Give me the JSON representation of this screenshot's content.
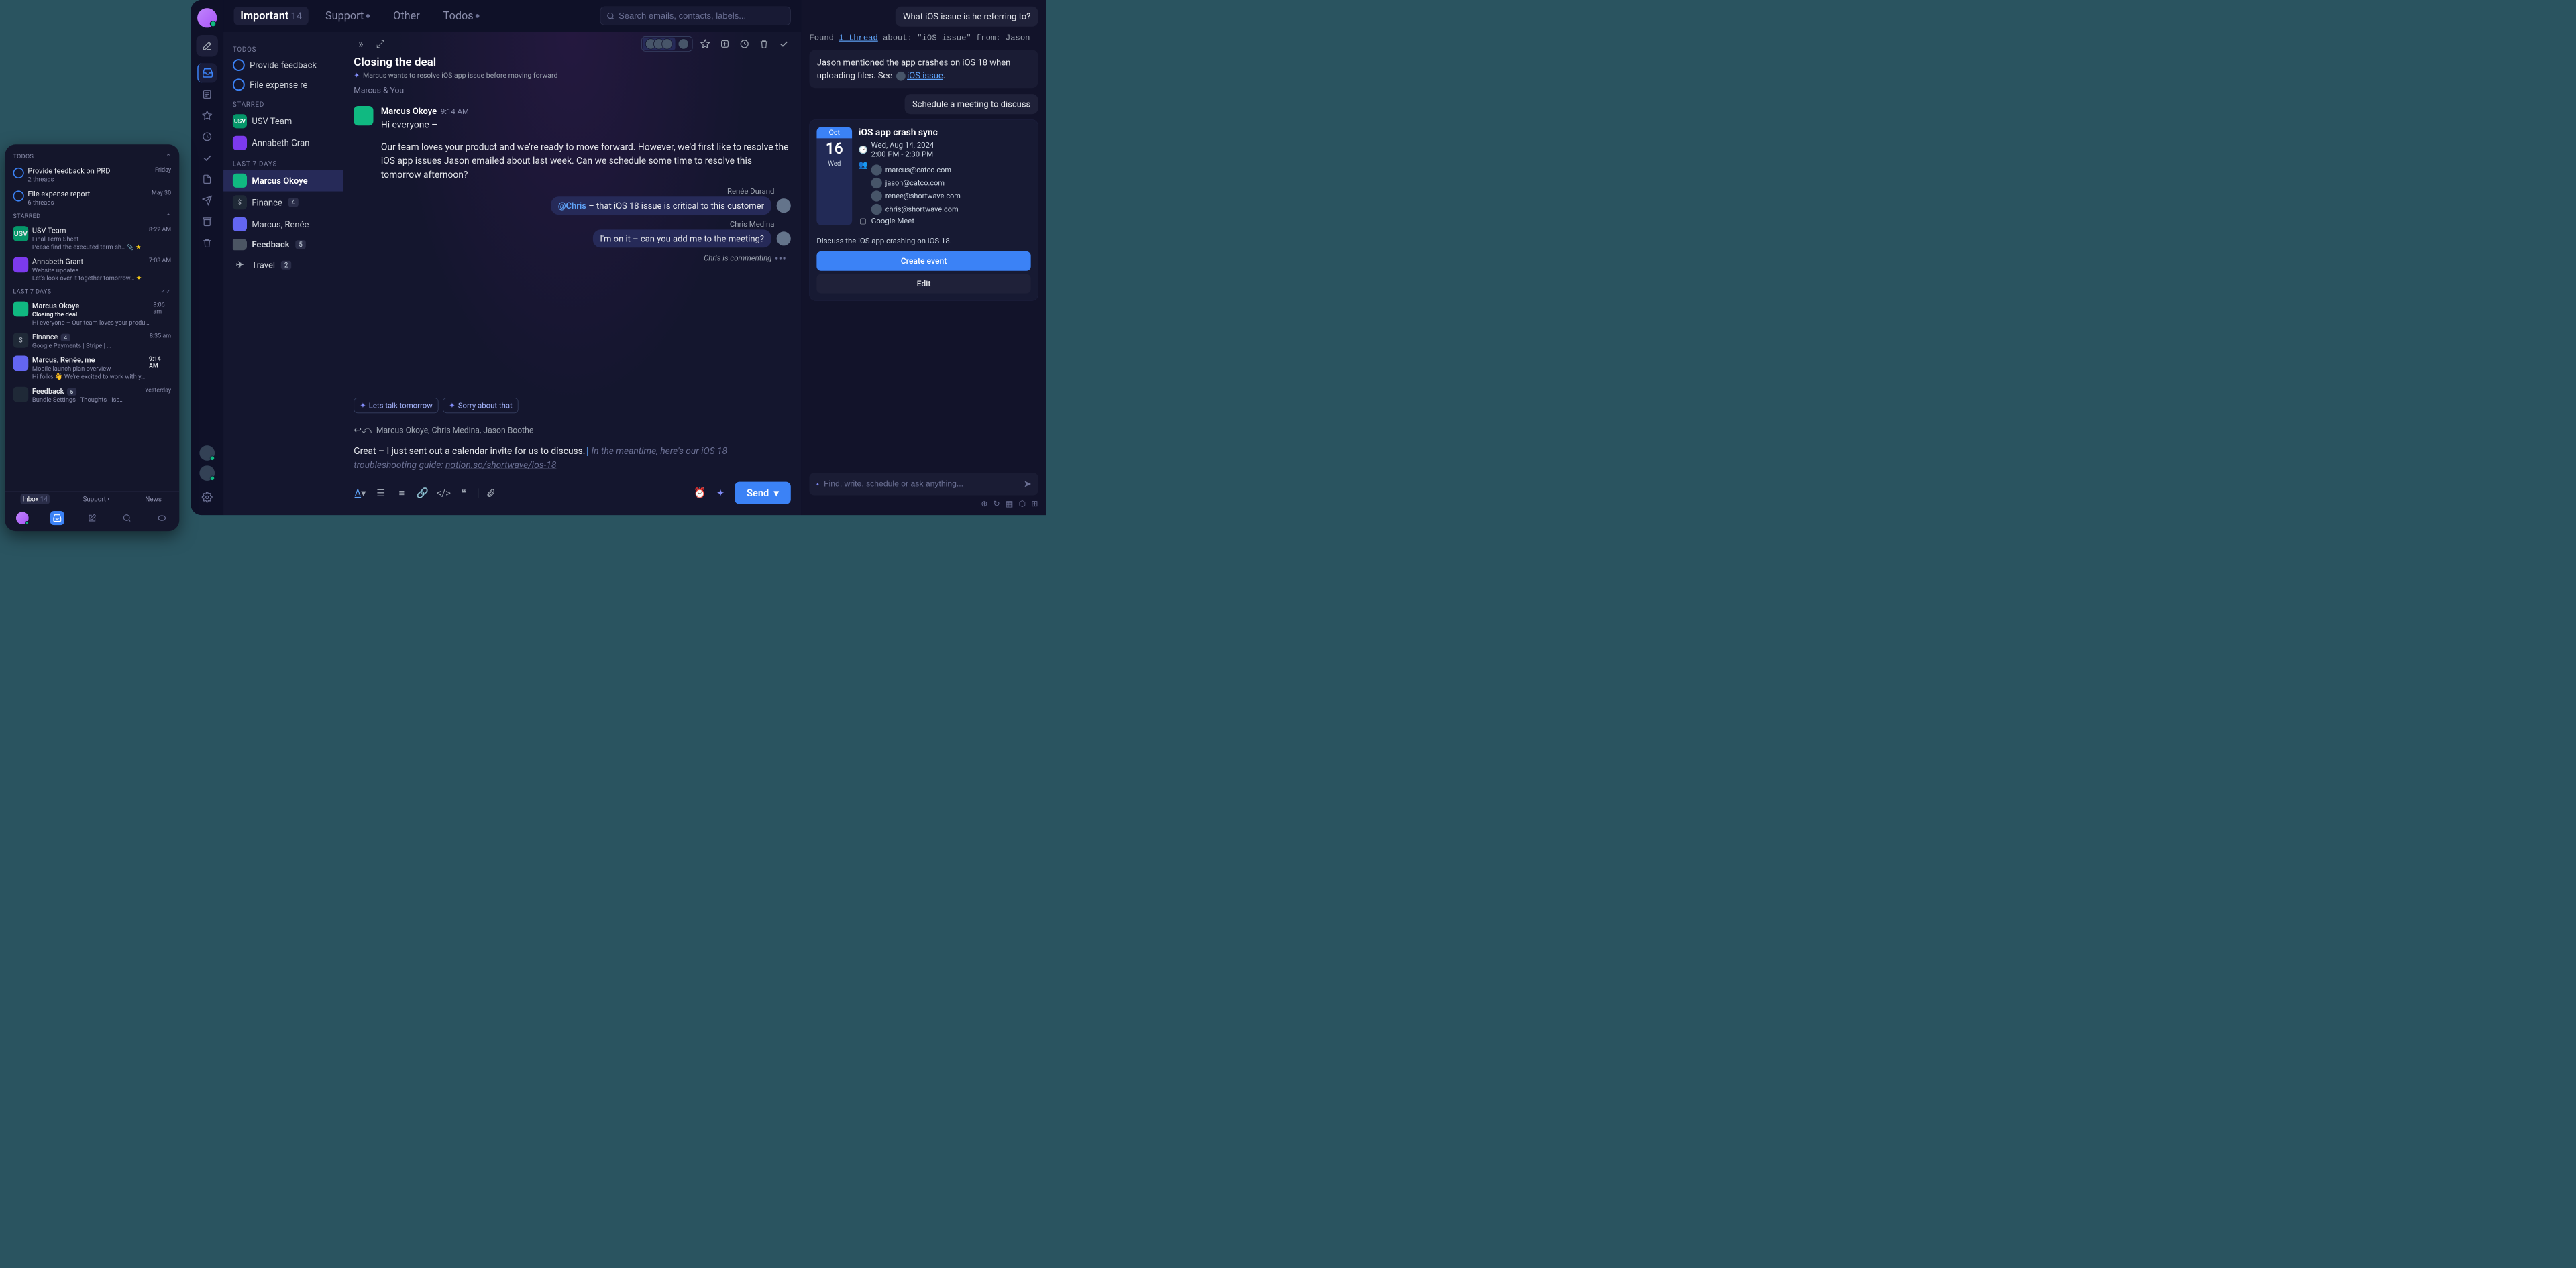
{
  "mobile": {
    "sections": {
      "todos": "TODOS",
      "starred": "STARRED",
      "last7": "LAST 7 DAYS"
    },
    "todos": [
      {
        "title": "Provide feedback on PRD",
        "sub": "2 threads",
        "time": "Friday"
      },
      {
        "title": "File expense report",
        "sub": "6 threads",
        "time": "May 30"
      }
    ],
    "starred": [
      {
        "name": "USV Team",
        "subject": "Final Term Sheet",
        "preview": "Pease find the executed term sh…",
        "time": "8:22 AM",
        "badge": "USV",
        "badge_bg": "#059669",
        "attach": true,
        "star": true
      },
      {
        "name": "Annabeth Grant",
        "subject": "Website updates",
        "preview": "Let's look over it together tomorrow…",
        "time": "7:03 AM",
        "star": true
      }
    ],
    "last7": [
      {
        "name": "Marcus Okoye",
        "subject": "Closing the deal",
        "preview": "Hi everyone – Our team loves your produ…",
        "time": "8:06 am",
        "bold": true
      },
      {
        "name": "Finance",
        "badge_count": "4",
        "icons_row": "Google Payments  |  Stripe  |  …",
        "time": "8:35 am",
        "icon": "$"
      },
      {
        "name": "Marcus, Renée, me",
        "subject": "Mobile launch plan overview",
        "preview": "Hi folks 👋 We're excited to work with y…",
        "time": "9:14 AM",
        "bold": true
      },
      {
        "name": "Feedback",
        "badge_count": "5",
        "subject": "Bundle Settings | Thoughts | Iss…",
        "time": "Yesterday"
      }
    ],
    "bottom_tabs": {
      "inbox": "Inbox",
      "inbox_count": "14",
      "support": "Support",
      "news": "News"
    }
  },
  "tabs": [
    {
      "label": "Important",
      "count": "14",
      "active": true
    },
    {
      "label": "Support",
      "dot": true
    },
    {
      "label": "Other"
    },
    {
      "label": "Todos",
      "dot": true
    }
  ],
  "search_placeholder": "Search emails, contacts, labels...",
  "list": {
    "sections": {
      "todos": "TODOS",
      "starred": "STARRED",
      "last7": "LAST 7 DAYS"
    },
    "todos": [
      {
        "label": "Provide feedback"
      },
      {
        "label": "File expense re"
      }
    ],
    "starred": [
      {
        "label": "USV Team",
        "badge": "USV",
        "bg": "#059669"
      },
      {
        "label": "Annabeth Gran"
      }
    ],
    "last7": [
      {
        "label": "Marcus Okoye",
        "active": true
      },
      {
        "label": "Finance",
        "count": "4",
        "icon": "$"
      },
      {
        "label": "Marcus, Renée"
      },
      {
        "label": "Feedback",
        "count": "5",
        "labelicon": true
      },
      {
        "label": "Travel",
        "count": "2",
        "icon": "✈"
      }
    ]
  },
  "thread": {
    "title": "Closing the deal",
    "summary": "Marcus wants to resolve iOS app issue before moving forward",
    "participants": "Marcus & You",
    "sender": "Marcus Okoye",
    "sent_time": "9:14 AM",
    "greeting": "Hi everyone –",
    "body": "Our team loves your product and we're ready to move forward. However, we'd first like to resolve the iOS app issues Jason emailed about last week. Can we schedule some time to resolve this tomorrow afternoon?",
    "comments": [
      {
        "author": "Renée Durand",
        "mention": "@Chris",
        "text": " – that iOS 18 issue is critical to this customer"
      },
      {
        "author": "Chris Medina",
        "text": "I'm on it – can you add me to the meeting?"
      }
    ],
    "typing": "Chris is commenting",
    "suggestions": [
      "Lets talk tomorrow",
      "Sorry about that"
    ],
    "reply_to": "Marcus Okoye, Chris Medina, Jason Boothe",
    "reply_typed": "Great – I just sent out a calendar invite for us to discuss.",
    "reply_ai": " In the meantime, here's our iOS 18 troubleshooting guide: ",
    "reply_ai_link": "notion.so/shortwave/ios-18",
    "send": "Send"
  },
  "ai": {
    "user_q1": "What iOS issue is he referring to?",
    "ctx_found": "Found ",
    "ctx_link": "1 thread",
    "ctx_about": " about: \"iOS issue\" from: Jason",
    "resp1_a": "Jason mentioned the app crashes on iOS 18 when uploading files. See ",
    "resp1_link": "iOS issue",
    "resp1_b": ".",
    "user_q2": "Schedule a meeting to discuss",
    "event": {
      "month": "Oct",
      "day": "16",
      "dow": "Wed",
      "title": "iOS app crash sync",
      "date": "Wed, Aug 14, 2024",
      "time": "2:00 PM - 2:30 PM",
      "attendees": [
        "marcus@catco.com",
        "jason@catco.com",
        "renee@shortwave.com",
        "chris@shortwave.com"
      ],
      "meet": "Google Meet",
      "desc": "Discuss the iOS app crashing on iOS 18.",
      "create": "Create event",
      "edit": "Edit"
    },
    "input_placeholder": "Find, write, schedule or ask anything..."
  }
}
